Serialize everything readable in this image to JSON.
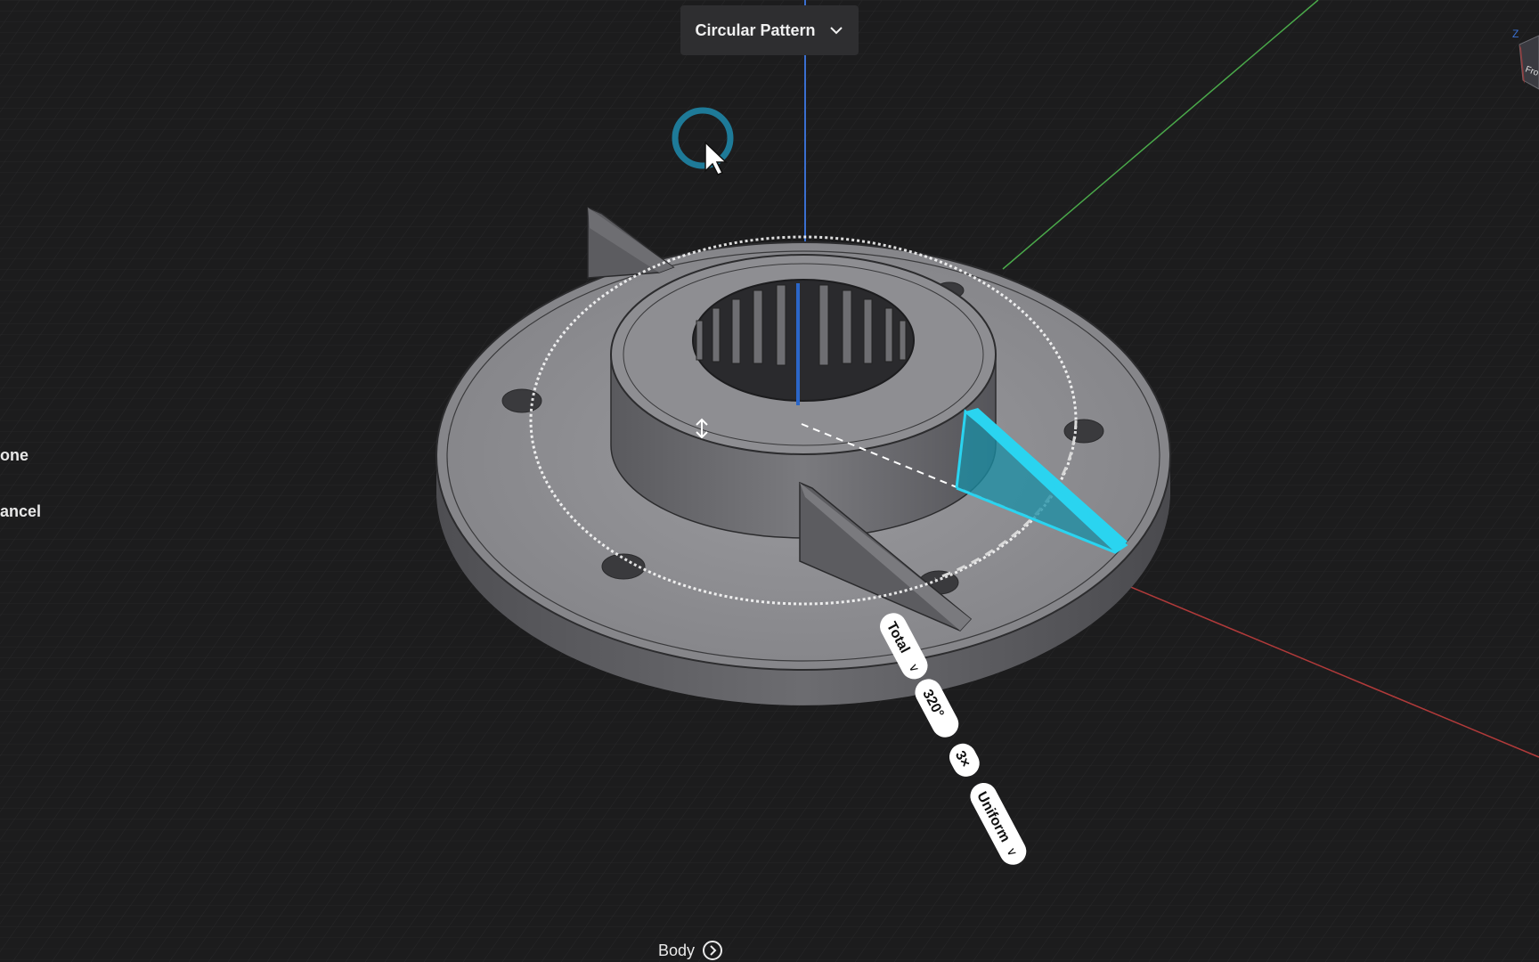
{
  "command": {
    "name": "Circular Pattern",
    "chevron_icon": "chevron-down-icon"
  },
  "side_actions": {
    "done_label": "one",
    "cancel_label": "ancel"
  },
  "pattern_params": {
    "distribution": "Total",
    "angle": "320°",
    "count": "3×",
    "spacing": "Uniform"
  },
  "bottom": {
    "body_label": "Body",
    "icon": "arrow-circle-right-icon"
  },
  "viewcube": {
    "axis_label": "Z",
    "face_label": "Fro"
  },
  "colors": {
    "background": "#1c1c1d",
    "accent": "#2ad4f0",
    "part": "#8a8a8e",
    "axis_x": "#b03a3a",
    "axis_y": "#4aa94a",
    "axis_z": "#3a6fd0"
  }
}
